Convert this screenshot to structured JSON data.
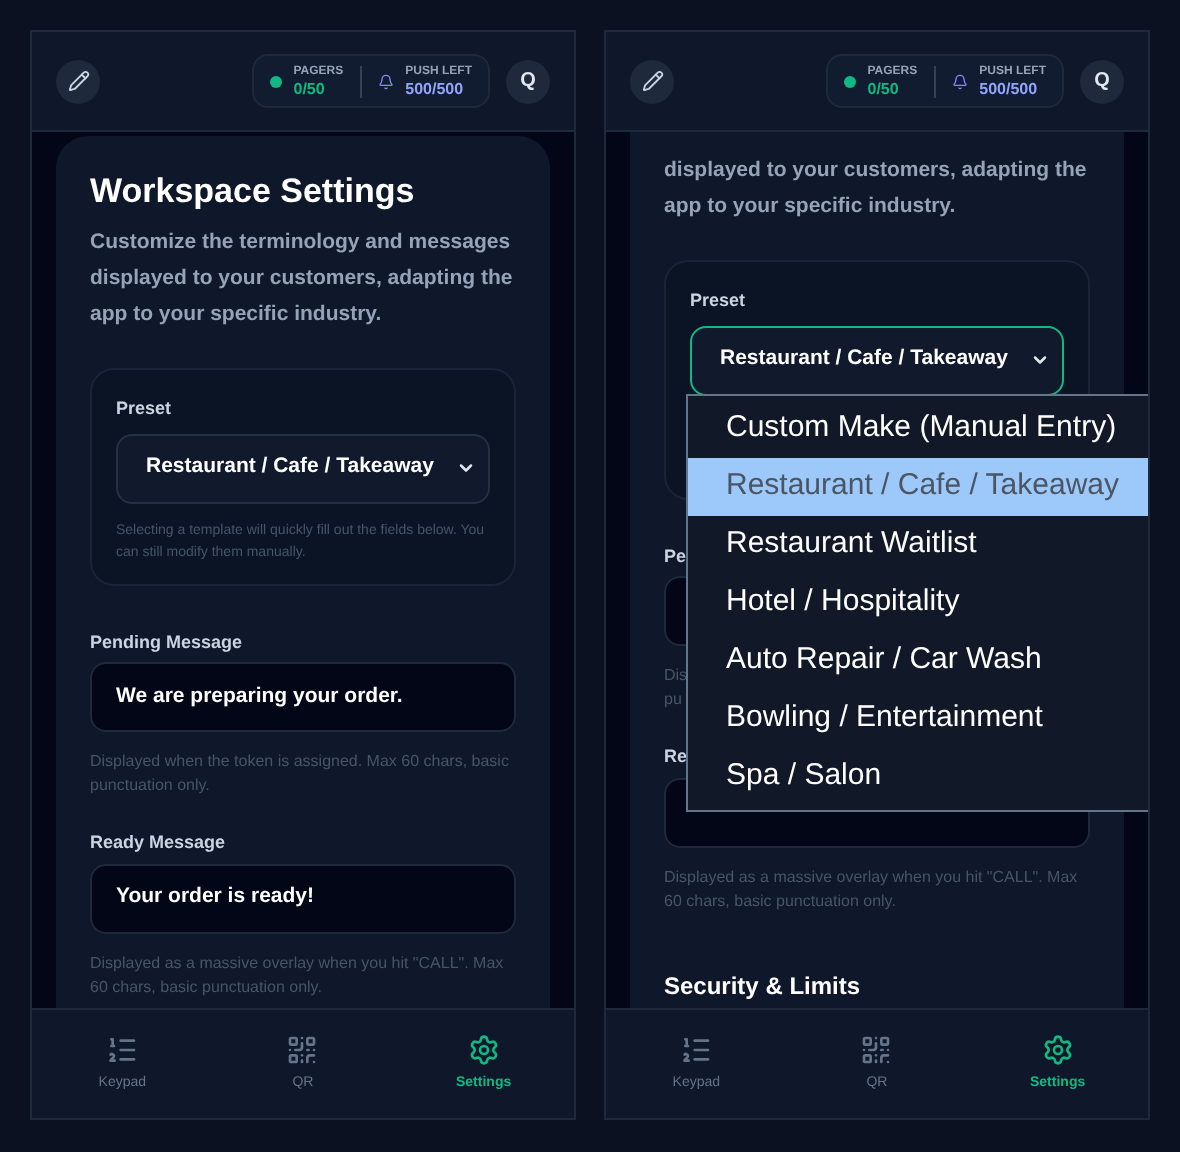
{
  "left_screen": {
    "header": {
      "pagers_label": "PAGERS",
      "pagers_value": "0/50",
      "push_label": "PUSH LEFT",
      "push_value": "500/500",
      "avatar": "Q"
    },
    "title": "Workspace Settings",
    "description": "Customize the terminology and messages displayed to your customers, adapting the app to your specific industry.",
    "preset": {
      "label": "Preset",
      "value": "Restaurant / Cafe / Takeaway",
      "focused": false,
      "hint": "Selecting a template will quickly fill out the fields below. You can still modify them manually."
    },
    "fields": [
      {
        "label": "Pending Message",
        "value": "We are preparing your order.",
        "hint_lines": [
          "Displayed when the token is assigned. Max 60 chars, basic",
          "punctuation only."
        ]
      },
      {
        "label": "Ready Message",
        "value": "Your order is ready!",
        "hint_lines": [
          "Displayed as a massive overlay when you hit \"CALL\". Max",
          "60 chars, basic punctuation only."
        ]
      }
    ],
    "nav": [
      {
        "kind": "keypad",
        "label": "Keypad",
        "selected": false
      },
      {
        "kind": "qr",
        "label": "QR",
        "selected": false
      },
      {
        "kind": "settings",
        "label": "Settings",
        "selected": true
      }
    ]
  },
  "right_screen": {
    "header": {
      "pagers_label": "PAGERS",
      "pagers_value": "0/50",
      "push_label": "PUSH LEFT",
      "push_value": "500/500",
      "avatar": "Q"
    },
    "description": "displayed to your customers, adapting the app to your specific industry.",
    "preset": {
      "label": "Preset",
      "value": "Restaurant / Cafe / Takeaway",
      "focused": true
    },
    "fields": [
      {
        "label": "Pe",
        "hint_lines": [
          "Dis",
          "pu"
        ]
      },
      {
        "label": "Re",
        "hint_lines": [
          "Displayed as a massive overlay when you hit \"CALL\". Max",
          "60 chars, basic punctuation only."
        ]
      }
    ],
    "section_title": "Security & Limits",
    "dropdown": [
      {
        "label": "Custom Make (Manual Entry)",
        "selected": false
      },
      {
        "label": "Restaurant / Cafe / Takeaway",
        "selected": true
      },
      {
        "label": "Restaurant Waitlist",
        "selected": false
      },
      {
        "label": "Hotel / Hospitality",
        "selected": false
      },
      {
        "label": "Auto Repair / Car Wash",
        "selected": false
      },
      {
        "label": "Bowling / Entertainment",
        "selected": false
      },
      {
        "label": "Spa / Salon",
        "selected": false
      }
    ],
    "nav": [
      {
        "kind": "keypad",
        "label": "Keypad",
        "selected": false
      },
      {
        "kind": "qr",
        "label": "QR",
        "selected": false
      },
      {
        "kind": "settings",
        "label": "Settings",
        "selected": true
      }
    ]
  }
}
